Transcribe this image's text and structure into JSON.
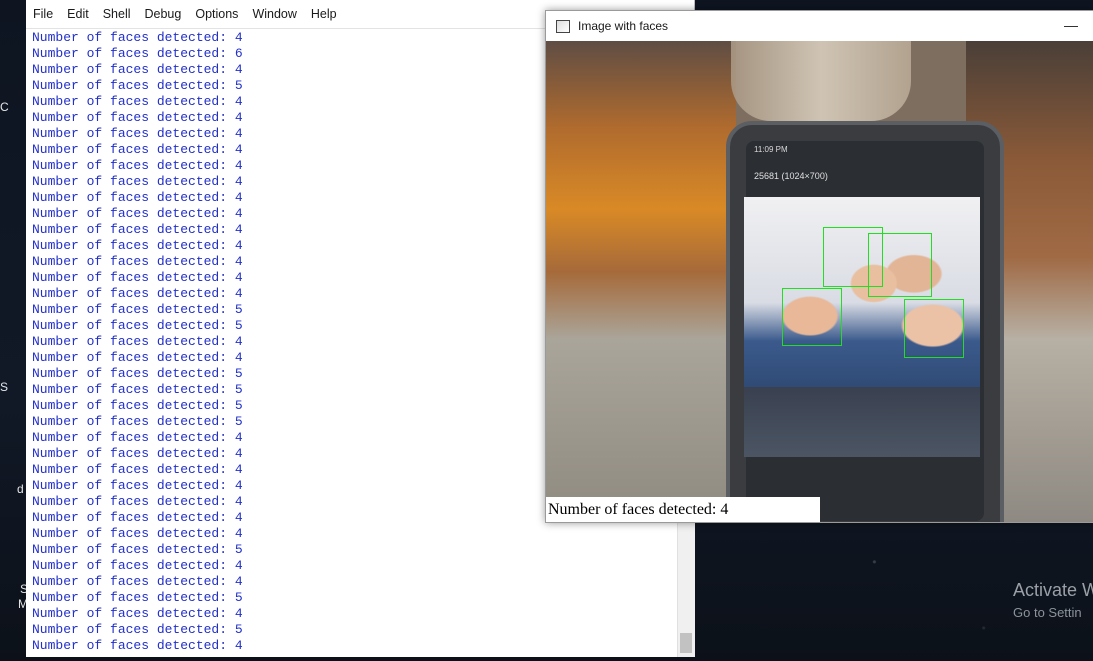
{
  "desktop": {
    "left_labels": [
      "C",
      "S",
      "d",
      "S",
      "M"
    ],
    "activate_title": "Activate W",
    "activate_sub": "Go to Settin"
  },
  "shell": {
    "menu": [
      "File",
      "Edit",
      "Shell",
      "Debug",
      "Options",
      "Window",
      "Help"
    ],
    "output_lines": [
      "Number of faces detected: 4",
      "Number of faces detected: 6",
      "Number of faces detected: 4",
      "Number of faces detected: 5",
      "Number of faces detected: 4",
      "Number of faces detected: 4",
      "Number of faces detected: 4",
      "Number of faces detected: 4",
      "Number of faces detected: 4",
      "Number of faces detected: 4",
      "Number of faces detected: 4",
      "Number of faces detected: 4",
      "Number of faces detected: 4",
      "Number of faces detected: 4",
      "Number of faces detected: 4",
      "Number of faces detected: 4",
      "Number of faces detected: 4",
      "Number of faces detected: 5",
      "Number of faces detected: 5",
      "Number of faces detected: 4",
      "Number of faces detected: 4",
      "Number of faces detected: 5",
      "Number of faces detected: 5",
      "Number of faces detected: 5",
      "Number of faces detected: 5",
      "Number of faces detected: 4",
      "Number of faces detected: 4",
      "Number of faces detected: 4",
      "Number of faces detected: 4",
      "Number of faces detected: 4",
      "Number of faces detected: 4",
      "Number of faces detected: 4",
      "Number of faces detected: 5",
      "Number of faces detected: 4",
      "Number of faces detected: 4",
      "Number of faces detected: 5",
      "Number of faces detected: 4",
      "Number of faces detected: 5",
      "Number of faces detected: 4"
    ]
  },
  "image_window": {
    "title": "Image with faces",
    "minimize_glyph": "—",
    "overlay_text": "Number of faces detected: 4",
    "phone_status": "11:09 PM",
    "phone_appbar": "25681 (1024×700)",
    "box_color": "#22dd22"
  },
  "colors": {
    "output_text": "#2230c9"
  }
}
